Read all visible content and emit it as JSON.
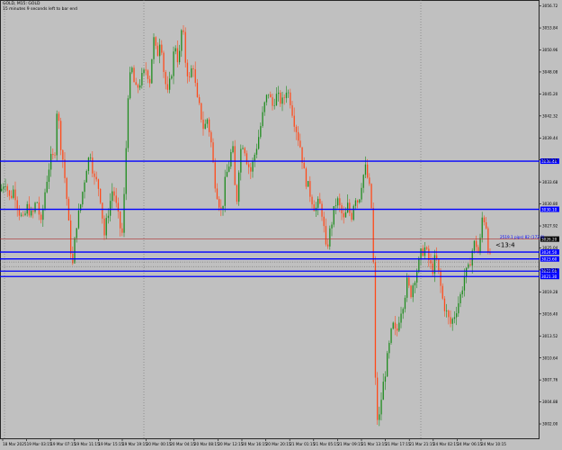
{
  "header": {
    "symbol_line": "GOLD, M15: GOLD",
    "info_line": "15 minutes 9 seconds left to bar end"
  },
  "colors": {
    "background": "#c0c0c0",
    "bull_candle": "#1e8c1e",
    "bear_candle": "#ff4a1a",
    "level_line": "#0000ff",
    "bid_line": "#b03030",
    "grid": "#707070",
    "axis_text": "#000000"
  },
  "chart_data": {
    "type": "candlestick",
    "timeframe": "M15",
    "ylim": [
      3000.0,
      3057.5
    ],
    "y_ticks": [
      3002.0,
      3004.88,
      3007.76,
      3010.64,
      3013.52,
      3016.4,
      3019.28,
      3022.16,
      3025.04,
      3027.92,
      3030.8,
      3033.68,
      3036.56,
      3039.44,
      3042.32,
      3045.2,
      3048.08,
      3050.96,
      3053.84,
      3056.72
    ],
    "x_labels": [
      "18 Mar 2025",
      "19 Mar 03:15",
      "19 Mar 07:15",
      "19 Mar 11:15",
      "19 Mar 15:15",
      "19 Mar 19:15",
      "20 Mar 00:15",
      "20 Mar 04:15",
      "20 Mar 08:15",
      "20 Mar 12:15",
      "20 Mar 16:15",
      "20 Mar 20:15",
      "21 Mar 01:15",
      "21 Mar 05:15",
      "21 Mar 09:15",
      "21 Mar 13:15",
      "21 Mar 17:15",
      "21 Mar 21:15",
      "24 Mar 02:15",
      "24 Mar 06:15",
      "24 Mar 10:15"
    ],
    "horizontal_levels": [
      3036.4,
      3030.1,
      3024.5,
      3023.6,
      3022.0,
      3021.3
    ],
    "current_price": 3026.2,
    "current_price_label": "3026.20",
    "annotations": {
      "price_info": "2519.1 pips) 82 (172.0)",
      "timer": "<13:4"
    },
    "close_path": [
      [
        0,
        3032.5
      ],
      [
        5,
        3034.0
      ],
      [
        10,
        3031.5
      ],
      [
        15,
        3032.8
      ],
      [
        20,
        3030.0
      ],
      [
        25,
        3028.5
      ],
      [
        30,
        3030.5
      ],
      [
        35,
        3029.0
      ],
      [
        40,
        3031.5
      ],
      [
        45,
        3028.0
      ],
      [
        50,
        3033.0
      ],
      [
        55,
        3036.5
      ],
      [
        60,
        3037.0
      ],
      [
        63,
        3044.0
      ],
      [
        66,
        3039.5
      ],
      [
        70,
        3036.0
      ],
      [
        74,
        3031.0
      ],
      [
        77,
        3026.0
      ],
      [
        80,
        3022.5
      ],
      [
        84,
        3028.0
      ],
      [
        88,
        3030.0
      ],
      [
        92,
        3033.0
      ],
      [
        96,
        3036.0
      ],
      [
        100,
        3037.5
      ],
      [
        104,
        3034.0
      ],
      [
        108,
        3033.5
      ],
      [
        112,
        3031.0
      ],
      [
        115,
        3026.5
      ],
      [
        120,
        3030.0
      ],
      [
        125,
        3033.0
      ],
      [
        130,
        3029.5
      ],
      [
        135,
        3026.5
      ],
      [
        138,
        3033.0
      ],
      [
        142,
        3046.0
      ],
      [
        146,
        3048.5
      ],
      [
        150,
        3045.5
      ],
      [
        154,
        3046.5
      ],
      [
        158,
        3047.5
      ],
      [
        162,
        3048.5
      ],
      [
        166,
        3047.0
      ],
      [
        170,
        3052.5
      ],
      [
        174,
        3050.0
      ],
      [
        178,
        3053.0
      ],
      [
        182,
        3047.5
      ],
      [
        186,
        3045.0
      ],
      [
        190,
        3048.0
      ],
      [
        194,
        3052.0
      ],
      [
        198,
        3049.0
      ],
      [
        202,
        3054.5
      ],
      [
        206,
        3049.0
      ],
      [
        210,
        3047.0
      ],
      [
        214,
        3049.5
      ],
      [
        218,
        3044.5
      ],
      [
        222,
        3043.0
      ],
      [
        226,
        3040.5
      ],
      [
        230,
        3042.0
      ],
      [
        234,
        3039.0
      ],
      [
        238,
        3034.0
      ],
      [
        242,
        3031.5
      ],
      [
        246,
        3029.5
      ],
      [
        250,
        3034.0
      ],
      [
        254,
        3036.0
      ],
      [
        258,
        3038.5
      ],
      [
        262,
        3030.0
      ],
      [
        266,
        3037.5
      ],
      [
        270,
        3039.0
      ],
      [
        274,
        3036.5
      ],
      [
        278,
        3035.0
      ],
      [
        282,
        3037.0
      ],
      [
        286,
        3039.0
      ],
      [
        290,
        3041.5
      ],
      [
        294,
        3044.0
      ],
      [
        298,
        3045.5
      ],
      [
        302,
        3043.5
      ],
      [
        306,
        3045.0
      ],
      [
        310,
        3044.5
      ],
      [
        314,
        3044.0
      ],
      [
        318,
        3046.0
      ],
      [
        322,
        3044.5
      ],
      [
        326,
        3042.0
      ],
      [
        330,
        3040.0
      ],
      [
        334,
        3038.0
      ],
      [
        338,
        3034.5
      ],
      [
        342,
        3033.0
      ],
      [
        346,
        3031.5
      ],
      [
        350,
        3030.0
      ],
      [
        354,
        3031.0
      ],
      [
        358,
        3029.5
      ],
      [
        362,
        3024.5
      ],
      [
        366,
        3027.0
      ],
      [
        370,
        3029.5
      ],
      [
        374,
        3031.5
      ],
      [
        378,
        3030.0
      ],
      [
        382,
        3028.5
      ],
      [
        386,
        3030.5
      ],
      [
        390,
        3029.0
      ],
      [
        394,
        3032.0
      ],
      [
        398,
        3031.0
      ],
      [
        402,
        3034.0
      ],
      [
        406,
        3035.5
      ],
      [
        410,
        3033.0
      ],
      [
        414,
        3028.5
      ],
      [
        416,
        3010.0
      ],
      [
        418,
        3004.0
      ],
      [
        420,
        3001.5
      ],
      [
        424,
        3006.0
      ],
      [
        428,
        3009.0
      ],
      [
        432,
        3012.0
      ],
      [
        436,
        3015.0
      ],
      [
        440,
        3013.5
      ],
      [
        444,
        3016.5
      ],
      [
        448,
        3018.0
      ],
      [
        452,
        3020.5
      ],
      [
        456,
        3019.0
      ],
      [
        460,
        3021.0
      ],
      [
        464,
        3022.5
      ],
      [
        468,
        3024.5
      ],
      [
        472,
        3025.0
      ],
      [
        476,
        3023.5
      ],
      [
        480,
        3022.0
      ],
      [
        484,
        3024.0
      ],
      [
        488,
        3021.0
      ],
      [
        492,
        3018.0
      ],
      [
        496,
        3016.5
      ],
      [
        500,
        3015.0
      ],
      [
        504,
        3016.0
      ],
      [
        508,
        3017.5
      ],
      [
        512,
        3019.0
      ],
      [
        516,
        3021.5
      ],
      [
        520,
        3022.0
      ],
      [
        524,
        3024.5
      ],
      [
        528,
        3026.0
      ],
      [
        532,
        3024.0
      ],
      [
        536,
        3029.5
      ],
      [
        540,
        3028.0
      ],
      [
        544,
        3023.0
      ],
      [
        546,
        3026.0
      ]
    ]
  }
}
